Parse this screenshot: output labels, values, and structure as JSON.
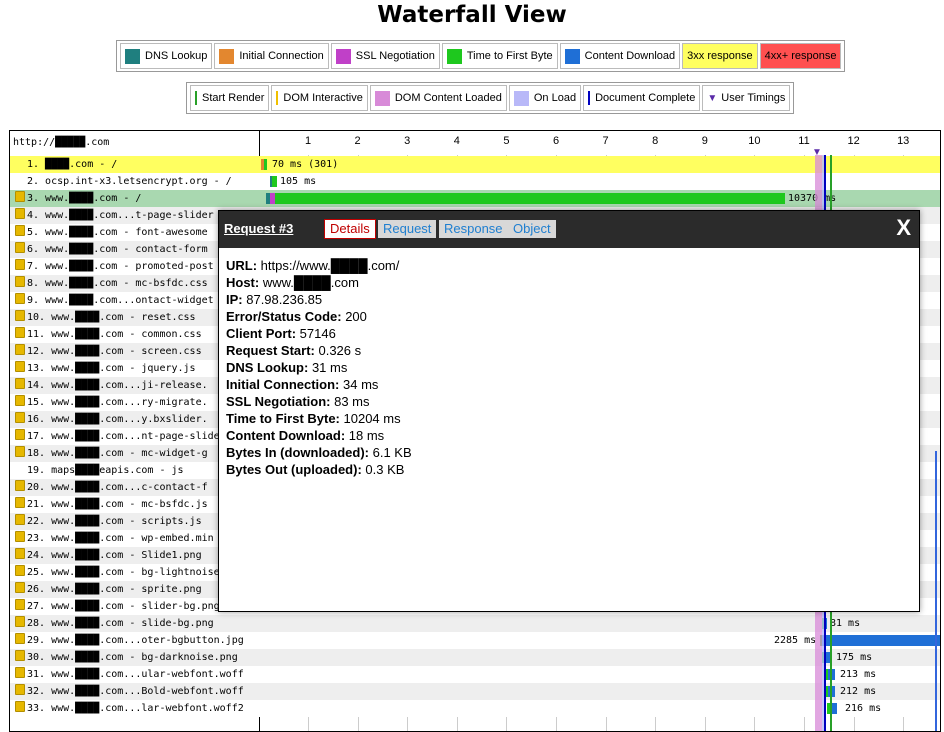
{
  "title": "Waterfall View",
  "legend1": [
    {
      "label": "DNS Lookup",
      "color": "#1f7f7f",
      "kind": "swatch"
    },
    {
      "label": "Initial Connection",
      "color": "#e3872f",
      "kind": "swatch"
    },
    {
      "label": "SSL Negotiation",
      "color": "#c040c8",
      "kind": "swatch"
    },
    {
      "label": "Time to First Byte",
      "color": "#1ec81e",
      "kind": "swatch"
    },
    {
      "label": "Content Download",
      "color": "#1f6fd6",
      "kind": "swatch"
    },
    {
      "label": "3xx response",
      "color": "#ffff60",
      "kind": "bg"
    },
    {
      "label": "4xx+ response",
      "color": "#ff5050",
      "kind": "bg"
    }
  ],
  "legend2": [
    {
      "label": "Start Render",
      "color": "#28a028",
      "kind": "line"
    },
    {
      "label": "DOM Interactive",
      "color": "#f0c000",
      "kind": "line"
    },
    {
      "label": "DOM Content Loaded",
      "color": "#d88ad8",
      "kind": "swatch"
    },
    {
      "label": "On Load",
      "color": "#b8b8f8",
      "kind": "swatch"
    },
    {
      "label": "Document Complete",
      "color": "#0000c0",
      "kind": "line"
    },
    {
      "label": "User Timings",
      "color": "#5a2ba8",
      "kind": "triangle"
    }
  ],
  "waterfall": {
    "url": "http://█████.com",
    "ticks": [
      "1",
      "2",
      "3",
      "4",
      "5",
      "6",
      "7",
      "8",
      "9",
      "10",
      "11",
      "12",
      "13"
    ],
    "rows": [
      {
        "label": "1. ████.com - /",
        "lock": false,
        "bg": "#ffff60",
        "dur": "70 ms (301)"
      },
      {
        "label": "2. ocsp.int-x3.letsencrypt.org - /",
        "lock": false,
        "bg": "#ffffff",
        "dur": "105 ms"
      },
      {
        "label": "3. www.████.com - /",
        "lock": true,
        "bg": "#a9d8b0",
        "dur": "10370 ms"
      },
      {
        "label": "4. www.████.com...t-page-slider",
        "lock": true,
        "bg": "#eeeeee",
        "dur": ""
      },
      {
        "label": "5. www.████.com - font-awesome",
        "lock": true,
        "bg": "#ffffff",
        "dur": ""
      },
      {
        "label": "6. www.████.com - contact-form",
        "lock": true,
        "bg": "#eeeeee",
        "dur": ""
      },
      {
        "label": "7. www.████.com - promoted-post",
        "lock": true,
        "bg": "#ffffff",
        "dur": ""
      },
      {
        "label": "8. www.████.com - mc-bsfdc.css",
        "lock": true,
        "bg": "#eeeeee",
        "dur": ""
      },
      {
        "label": "9. www.████.com...ontact-widget",
        "lock": true,
        "bg": "#ffffff",
        "dur": ""
      },
      {
        "label": "10. www.████.com - reset.css",
        "lock": true,
        "bg": "#eeeeee",
        "dur": ""
      },
      {
        "label": "11. www.████.com - common.css",
        "lock": true,
        "bg": "#ffffff",
        "dur": ""
      },
      {
        "label": "12. www.████.com - screen.css",
        "lock": true,
        "bg": "#eeeeee",
        "dur": ""
      },
      {
        "label": "13. www.████.com - jquery.js",
        "lock": true,
        "bg": "#ffffff",
        "dur": ""
      },
      {
        "label": "14. www.████.com...ji-release.",
        "lock": true,
        "bg": "#eeeeee",
        "dur": ""
      },
      {
        "label": "15. www.████.com...ry-migrate.",
        "lock": true,
        "bg": "#ffffff",
        "dur": ""
      },
      {
        "label": "16. www.████.com...y.bxslider.",
        "lock": true,
        "bg": "#eeeeee",
        "dur": ""
      },
      {
        "label": "17. www.████.com...nt-page-slider",
        "lock": true,
        "bg": "#ffffff",
        "dur": ""
      },
      {
        "label": "18. www.████.com - mc-widget-g",
        "lock": true,
        "bg": "#eeeeee",
        "dur": ""
      },
      {
        "label": "19. maps████eapis.com - js",
        "lock": false,
        "bg": "#ffffff",
        "dur": ""
      },
      {
        "label": "20. www.████.com...c-contact-f",
        "lock": true,
        "bg": "#eeeeee",
        "dur": ""
      },
      {
        "label": "21. www.████.com - mc-bsfdc.js",
        "lock": true,
        "bg": "#ffffff",
        "dur": ""
      },
      {
        "label": "22. www.████.com - scripts.js",
        "lock": true,
        "bg": "#eeeeee",
        "dur": ""
      },
      {
        "label": "23. www.████.com - wp-embed.min",
        "lock": true,
        "bg": "#ffffff",
        "dur": ""
      },
      {
        "label": "24. www.████.com - Slide1.png",
        "lock": true,
        "bg": "#eeeeee",
        "dur": ""
      },
      {
        "label": "25. www.████.com - bg-lightnoise",
        "lock": true,
        "bg": "#ffffff",
        "dur": ""
      },
      {
        "label": "26. www.████.com - sprite.png",
        "lock": true,
        "bg": "#eeeeee",
        "dur": ""
      },
      {
        "label": "27. www.████.com - slider-bg.png",
        "lock": true,
        "bg": "#ffffff",
        "dur": ""
      },
      {
        "label": "28. www.████.com - slide-bg.png",
        "lock": true,
        "bg": "#eeeeee",
        "dur": "81 ms"
      },
      {
        "label": "29. www.████.com...oter-bgbutton.jpg",
        "lock": true,
        "bg": "#ffffff",
        "dur": "2285 ms"
      },
      {
        "label": "30. www.████.com - bg-darknoise.png",
        "lock": true,
        "bg": "#eeeeee",
        "dur": "175 ms"
      },
      {
        "label": "31. www.████.com...ular-webfont.woff",
        "lock": true,
        "bg": "#ffffff",
        "dur": "213 ms"
      },
      {
        "label": "32. www.████.com...Bold-webfont.woff",
        "lock": true,
        "bg": "#eeeeee",
        "dur": "212 ms"
      },
      {
        "label": "33. www.████.com...lar-webfont.woff2",
        "lock": true,
        "bg": "#ffffff",
        "dur": "216 ms"
      }
    ]
  },
  "popup": {
    "title": "Request #3",
    "tabs": [
      "Details",
      "Request",
      "Response",
      "Object"
    ],
    "close": "X",
    "details": [
      {
        "k": "URL:",
        "v": " https://www.████.com/"
      },
      {
        "k": "Host:",
        "v": " www.████.com"
      },
      {
        "k": "IP:",
        "v": " 87.98.236.85"
      },
      {
        "k": "Error/Status Code:",
        "v": " 200"
      },
      {
        "k": "Client Port:",
        "v": " 57146"
      },
      {
        "k": "Request Start:",
        "v": " 0.326 s"
      },
      {
        "k": "DNS Lookup:",
        "v": " 31 ms"
      },
      {
        "k": "Initial Connection:",
        "v": " 34 ms"
      },
      {
        "k": "SSL Negotiation:",
        "v": " 83 ms"
      },
      {
        "k": "Time to First Byte:",
        "v": " 10204 ms"
      },
      {
        "k": "Content Download:",
        "v": " 18 ms"
      },
      {
        "k": "Bytes In (downloaded):",
        "v": " 6.1 KB"
      },
      {
        "k": "Bytes Out (uploaded):",
        "v": " 0.3 KB"
      }
    ]
  }
}
